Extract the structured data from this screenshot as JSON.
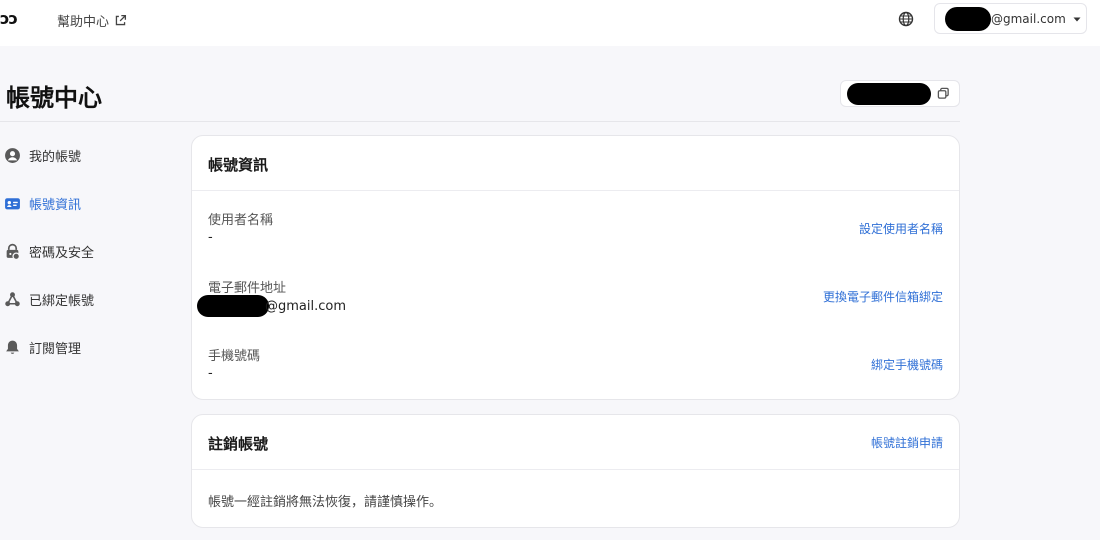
{
  "header": {
    "logo": "ɔɔ",
    "help_label": "幫助中心",
    "account_email_suffix": "@gmail.com"
  },
  "page": {
    "title": "帳號中心"
  },
  "sidebar": {
    "items": [
      {
        "label": "我的帳號",
        "icon": "user-circle-icon"
      },
      {
        "label": "帳號資訊",
        "icon": "id-card-icon"
      },
      {
        "label": "密碼及安全",
        "icon": "lock-shield-icon"
      },
      {
        "label": "已綁定帳號",
        "icon": "link-nodes-icon"
      },
      {
        "label": "訂閱管理",
        "icon": "bell-icon"
      }
    ],
    "active_index": 1
  },
  "account_info": {
    "title": "帳號資訊",
    "rows": [
      {
        "label": "使用者名稱",
        "value": "-",
        "action": "設定使用者名稱"
      },
      {
        "label": "電子郵件地址",
        "value_suffix": "@gmail.com",
        "action": "更換電子郵件信箱綁定"
      },
      {
        "label": "手機號碼",
        "value": "-",
        "action": "綁定手機號碼"
      }
    ]
  },
  "delete_account": {
    "title": "註銷帳號",
    "action": "帳號註銷申請",
    "note": "帳號一經註銷將無法恢復，請謹慎操作。"
  },
  "colors": {
    "accent": "#2f6fd6",
    "background": "#f7f7fa",
    "card": "#ffffff"
  }
}
